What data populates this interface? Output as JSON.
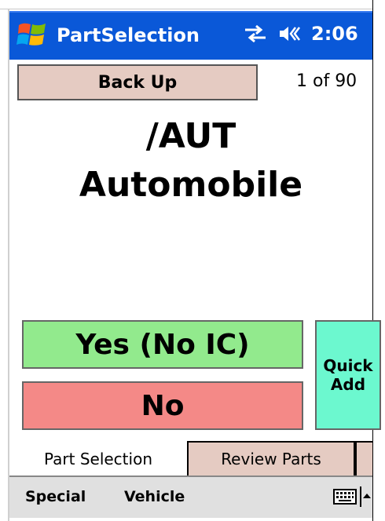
{
  "titlebar": {
    "title": "PartSelection",
    "clock": "2:06"
  },
  "navigation": {
    "back_label": "Back Up",
    "page_counter": "1 of 90"
  },
  "part": {
    "code": "/AUT",
    "description": "Automobile"
  },
  "actions": {
    "yes_label": "Yes (No IC)",
    "no_label": "No",
    "quick_add_line1": "Quick",
    "quick_add_line2": "Add"
  },
  "tabs": [
    {
      "label": "Part Selection",
      "active": true
    },
    {
      "label": "Review Parts",
      "active": false
    }
  ],
  "menubar": {
    "items": [
      {
        "label": "Special"
      },
      {
        "label": "Vehicle"
      }
    ]
  },
  "colors": {
    "titlebar": "#0a58d8",
    "back_button": "#e5cbc2",
    "yes_button": "#92ea8d",
    "no_button": "#f48987",
    "quick_add_button": "#6cf8cf",
    "menubar": "#e0e0e0"
  }
}
